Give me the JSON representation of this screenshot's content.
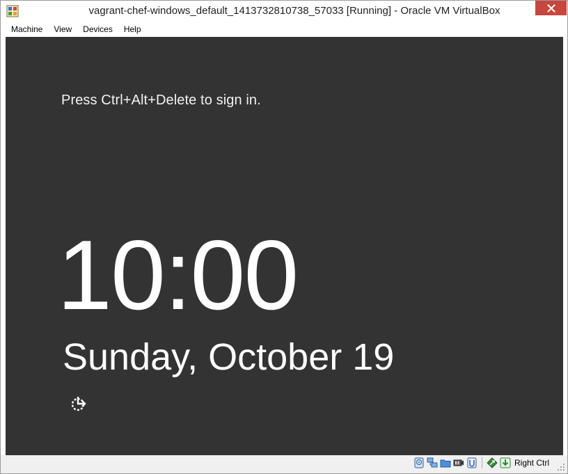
{
  "window": {
    "title": "vagrant-chef-windows_default_1413732810738_57033 [Running] - Oracle VM VirtualBox",
    "app_icon": "virtualbox-icon",
    "close_icon": "close-icon"
  },
  "menu": {
    "items": [
      {
        "label": "Machine"
      },
      {
        "label": "View"
      },
      {
        "label": "Devices"
      },
      {
        "label": "Help"
      }
    ]
  },
  "guest": {
    "background": "#333333",
    "hint": "Press Ctrl+Alt+Delete to sign in.",
    "time": "10:00",
    "date": "Sunday, October 19",
    "ease_of_access_icon": "ease-of-access-icon"
  },
  "statusbar": {
    "icons": [
      "hard-disk-icon",
      "network-icon",
      "shared-folders-icon",
      "video-capture-icon",
      "usb-icon",
      "mouse-integration-icon",
      "host-key-icon"
    ],
    "host_key": "Right Ctrl"
  },
  "colors": {
    "close_button": "#c7463d",
    "guest_screen": "#333333"
  }
}
